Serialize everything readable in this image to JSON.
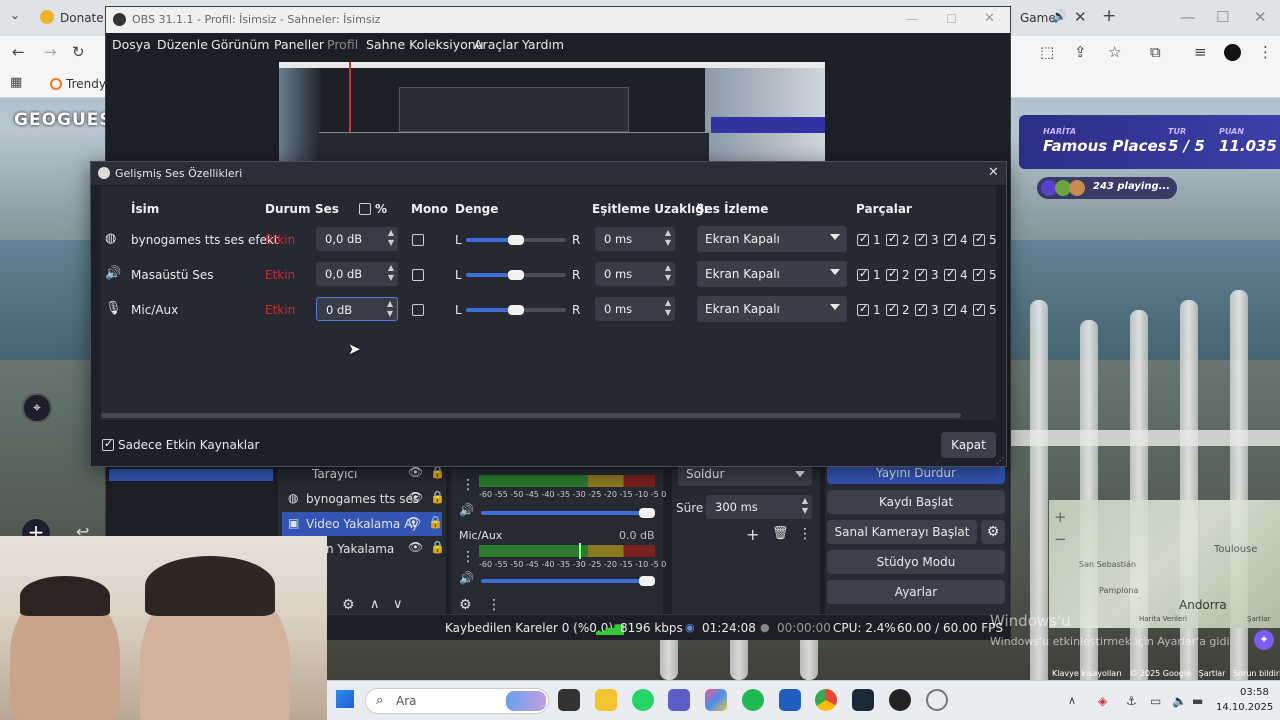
{
  "browser": {
    "tab1_title": "Donate By",
    "tab2_title": "Game",
    "bookmark1": "Trendyol"
  },
  "obs": {
    "window_title": "OBS 31.1.1 - Profil: İsimsiz - Sahneler: İsimsiz",
    "menu": [
      "Dosya",
      "Düzenle",
      "Görünüm",
      "Paneller",
      "Profil",
      "Sahne Koleksiyonu",
      "Araçlar",
      "Yardım"
    ],
    "sources": [
      {
        "label": "Tarayıcı"
      },
      {
        "label": "bynogames tts ses"
      },
      {
        "label": "Video Yakalama Ay"
      },
      {
        "label": "n Yakalama"
      }
    ],
    "mixer": {
      "mic_label": "Mic/Aux",
      "mic_db": "0.0 dB",
      "scale": "-60 -55 -50 -45 -40 -35 -30 -25 -20 -15 -10 -5 0"
    },
    "transition": {
      "type": "Soldur",
      "duration_label": "Süre",
      "duration_value": "300 ms"
    },
    "controls": {
      "stop_stream": "Yayını Durdur",
      "start_record": "Kaydı Başlat",
      "start_vcam": "Sanal Kamerayı Başlat",
      "studio_mode": "Stüdyo Modu",
      "settings": "Ayarlar"
    },
    "status": {
      "dropped": "Kaybedilen Kareler 0 (%0.0)",
      "bitrate": "8196 kbps",
      "stream_time": "01:24:08",
      "record_time": "00:00:00",
      "cpu": "CPU: 2.4%",
      "fps": "60.00 / 60.00 FPS"
    }
  },
  "dialog": {
    "title": "Gelişmiş Ses Özellikleri",
    "headers": {
      "name": "İsim",
      "status": "Durum",
      "volume": "Ses",
      "percent": "%",
      "mono": "Mono",
      "balance": "Denge",
      "sync": "Eşitleme Uzaklığı",
      "monitoring": "Ses İzleme",
      "tracks": "Parçalar"
    },
    "rows": [
      {
        "name": "bynogames tts ses efekt",
        "status": "Etkin",
        "volume": "0,0 dB",
        "balance_L": "L",
        "balance_R": "R",
        "sync": "0 ms",
        "monitoring": "Ekran Kapalı",
        "icon": "globe-icon"
      },
      {
        "name": "Masaüstü Ses",
        "status": "Etkin",
        "volume": "0,0 dB",
        "balance_L": "L",
        "balance_R": "R",
        "sync": "0 ms",
        "monitoring": "Ekran Kapalı",
        "icon": "speaker-icon"
      },
      {
        "name": "Mic/Aux",
        "status": "Etkin",
        "volume": "0 dB",
        "balance_L": "L",
        "balance_R": "R",
        "sync": "0 ms",
        "monitoring": "Ekran Kapalı",
        "icon": "microphone-icon"
      }
    ],
    "balance_level": 0.5,
    "tracks": [
      "1",
      "2",
      "3",
      "4",
      "5"
    ],
    "footer_checkbox": "Sadece Etkin Kaynaklar",
    "close": "Kapat"
  },
  "geoguessr": {
    "logo": "GEOGUESSR",
    "map_label": "HARİTA",
    "map_name": "Famous Places",
    "round_label": "TUR",
    "round_value": "5 / 5",
    "score_label": "PUAN",
    "score_value": "11.035",
    "playing": "243 playing...",
    "map_places": [
      "Toulouse",
      "San Sebastián",
      "Pamplona",
      "Andorra"
    ],
    "map_credit": "Harita Verileri",
    "map_terms": "Şartlar",
    "footer": [
      "Klavye kısayolları",
      "© 2025 Google",
      "Şartlar",
      "Sorun bildirin"
    ]
  },
  "windows": {
    "activation_title": "Windows'u",
    "activation_text": "Windows'u etkinleştirmek için Ayarlar'a gidin.",
    "search_placeholder": "Ara",
    "time": "03:58",
    "date": "14.10.2025"
  }
}
